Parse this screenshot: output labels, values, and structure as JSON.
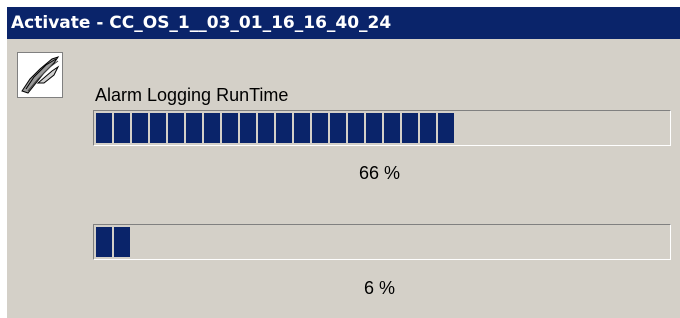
{
  "window": {
    "title": "Activate - CC_OS_1__03_01_16_16_40_24",
    "icon": "wincc-activate-icon"
  },
  "task": {
    "label": "Alarm Logging RunTime"
  },
  "progress_primary": {
    "percent": 66,
    "text": "66 %"
  },
  "progress_overall": {
    "percent": 6,
    "text": "6 %"
  },
  "colors": {
    "titlebar": "#0a246a",
    "progress_fill": "#0a246a",
    "window_bg": "#d4d0c8"
  }
}
